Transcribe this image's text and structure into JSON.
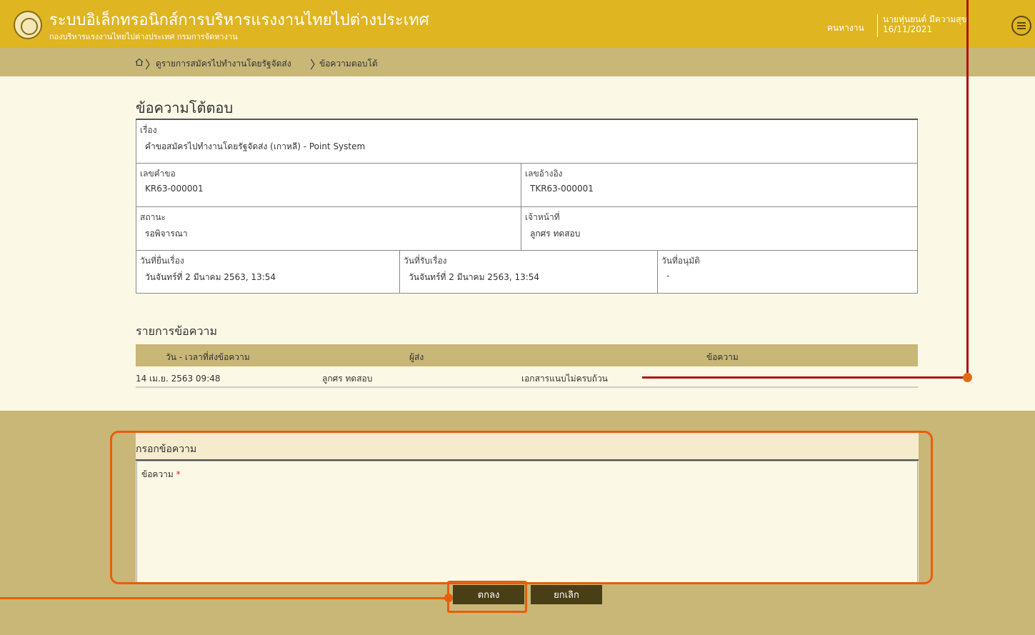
{
  "header": {
    "app_title": "ระบบอิเล็กทรอนิกส์การบริหารแรงงานไทยไปต่างประเทศ",
    "app_subtitle": "กองบริหารแรงงานไทยไปต่างประเทศ กรมการจัดหางาน",
    "role_link": "คนหางาน",
    "user_name": "นายหุ่นยนต์ มีความสุข",
    "user_date": "16/11/2021",
    "menu_icon": "hamburger-circle-icon"
  },
  "breadcrumb": {
    "home_icon": "home-icon",
    "items": [
      "ดูรายการสมัครไปทำงานโดยรัฐจัดส่ง",
      "ข้อความตอบโต้"
    ]
  },
  "page": {
    "title": "ข้อความโต้ตอบ"
  },
  "info": {
    "subject": {
      "label": "เรื่อง",
      "value": "คำขอสมัครไปทำงานโดยรัฐจัดส่ง (เกาหลี) - Point System"
    },
    "request_no": {
      "label": "เลขคำขอ",
      "value": "KR63-000001"
    },
    "reference_no": {
      "label": "เลขอ้างอิง",
      "value": "TKR63-000001"
    },
    "status": {
      "label": "สถานะ",
      "value": "รอพิจารณา"
    },
    "officer": {
      "label": "เจ้าหน้าที่",
      "value": "ลูกศร ทดสอบ"
    },
    "submitted_date": {
      "label": "วันที่ยื่นเรื่อง",
      "value": "วันจันทร์ที่ 2 มีนาคม 2563, 13:54"
    },
    "received_date": {
      "label": "วันที่รับเรื่อง",
      "value": "วันจันทร์ที่ 2 มีนาคม 2563, 13:54"
    },
    "approved_date": {
      "label": "วันที่อนุมัติ",
      "value": "-"
    }
  },
  "messages": {
    "title": "รายการข้อความ",
    "columns": [
      "วัน - เวลาที่ส่งข้อความ",
      "ผู้ส่ง",
      "ข้อความ"
    ],
    "rows": [
      {
        "datetime": "14 เม.ย. 2563 09:48",
        "sender": "ลูกศร ทดสอบ",
        "message": "เอกสารแนบไม่ครบถ้วน"
      }
    ]
  },
  "form": {
    "title": "กรอกข้อความ",
    "message_label": "ข้อความ",
    "required_mark": "*",
    "message_value": "",
    "submit_label": "ตกลง",
    "cancel_label": "ยกเลิก"
  },
  "colors": {
    "header_bg": "#dfb521",
    "tan_bg": "#c8b776",
    "content_bg": "#fcf8e6",
    "button_bg": "#4a3e16",
    "annotation_orange": "#e85d0c",
    "annotation_red": "#b01010"
  }
}
